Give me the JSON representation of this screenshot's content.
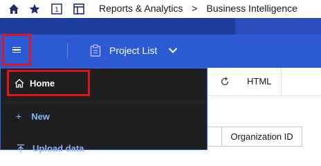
{
  "breadcrumb": {
    "items": [
      "Reports & Analytics",
      "Business Intelligence"
    ],
    "separator": ">"
  },
  "toolbar_icons": [
    "home-icon",
    "star-icon",
    "tab-one-icon",
    "layout-icon"
  ],
  "tab_badge": "1",
  "header": {
    "project_label": "Project List"
  },
  "side_panel": {
    "home_label": "Home",
    "new_label": "New",
    "upload_label": "Upload data"
  },
  "content_toolbar": {
    "html_label": "HTML"
  },
  "grid": {
    "columns": [
      "Organization ID"
    ]
  },
  "colors": {
    "accent_blue": "#2c5ad5",
    "highlight_red": "#e3131e",
    "panel_bg": "#1f1f1f",
    "link_blue": "#8ab4f8"
  }
}
